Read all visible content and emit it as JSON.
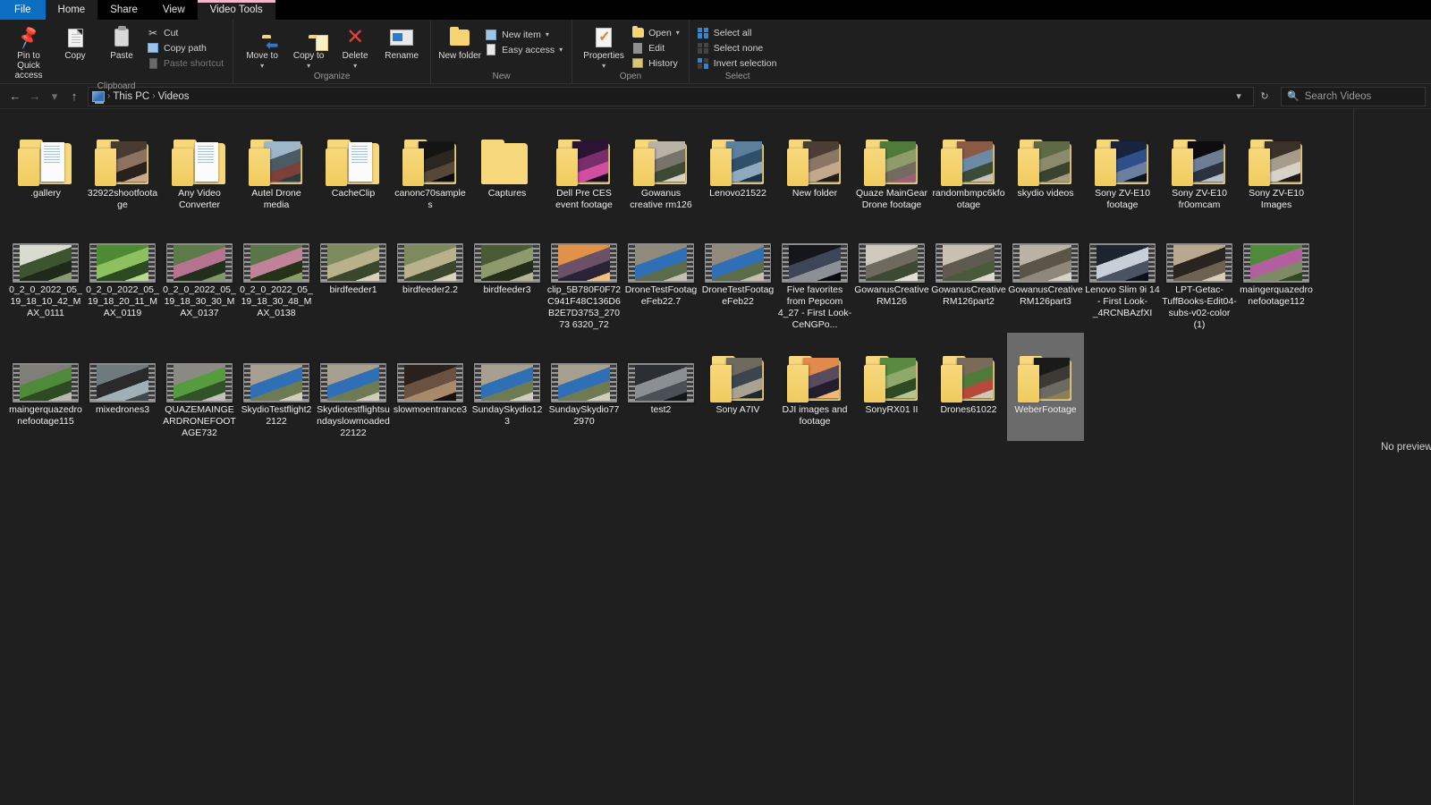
{
  "window": {
    "tabs": [
      {
        "id": "file",
        "label": "File",
        "kind": "file"
      },
      {
        "id": "home",
        "label": "Home",
        "kind": "active"
      },
      {
        "id": "share",
        "label": "Share",
        "kind": "normal"
      },
      {
        "id": "view",
        "label": "View",
        "kind": "normal"
      },
      {
        "id": "video-tools",
        "label": "Video Tools",
        "kind": "contextual"
      }
    ]
  },
  "ribbon": {
    "groups": [
      {
        "title": "Clipboard",
        "big": [
          {
            "name": "pin-to-quick-access",
            "label": "Pin to Quick access",
            "icon": "pin-icon"
          },
          {
            "name": "copy",
            "label": "Copy",
            "icon": "copy-icon"
          },
          {
            "name": "paste",
            "label": "Paste",
            "icon": "paste-icon"
          }
        ],
        "small": [
          {
            "name": "cut",
            "label": "Cut",
            "icon": "scissors-icon"
          },
          {
            "name": "copy-path",
            "label": "Copy path",
            "icon": "copy-path-icon"
          },
          {
            "name": "paste-shortcut",
            "label": "Paste shortcut",
            "icon": "paste-shortcut-icon",
            "disabled": true
          }
        ]
      },
      {
        "title": "Organize",
        "big": [
          {
            "name": "move-to",
            "label": "Move to",
            "icon": "move-to-icon",
            "caret": true
          },
          {
            "name": "copy-to",
            "label": "Copy to",
            "icon": "copy-to-icon",
            "caret": true
          },
          {
            "name": "delete",
            "label": "Delete",
            "icon": "delete-icon",
            "caret": true
          },
          {
            "name": "rename",
            "label": "Rename",
            "icon": "rename-icon"
          }
        ],
        "small": []
      },
      {
        "title": "New",
        "big": [
          {
            "name": "new-folder",
            "label": "New folder",
            "icon": "new-folder-icon"
          }
        ],
        "small": [
          {
            "name": "new-item",
            "label": "New item",
            "icon": "new-item-icon",
            "caret": true
          },
          {
            "name": "easy-access",
            "label": "Easy access",
            "icon": "easy-access-icon",
            "caret": true
          }
        ]
      },
      {
        "title": "Open",
        "big": [
          {
            "name": "properties",
            "label": "Properties",
            "icon": "properties-icon",
            "caret": true
          }
        ],
        "small": [
          {
            "name": "open",
            "label": "Open",
            "icon": "open-icon",
            "caret": true
          },
          {
            "name": "edit",
            "label": "Edit",
            "icon": "edit-icon"
          },
          {
            "name": "history",
            "label": "History",
            "icon": "history-icon"
          }
        ]
      },
      {
        "title": "Select",
        "big": [],
        "small": [
          {
            "name": "select-all",
            "label": "Select all",
            "icon": "select-all-icon"
          },
          {
            "name": "select-none",
            "label": "Select none",
            "icon": "select-none-icon"
          },
          {
            "name": "invert-selection",
            "label": "Invert selection",
            "icon": "invert-selection-icon"
          }
        ]
      }
    ]
  },
  "addressbar": {
    "back_icon": "back-arrow-icon",
    "forward_icon": "forward-arrow-icon",
    "recent_icon": "chevron-down-icon",
    "up_icon": "up-arrow-icon",
    "breadcrumb": [
      "This PC",
      "Videos"
    ],
    "separator": "›",
    "dropdown_icon": "chevron-down-icon",
    "refresh_icon": "refresh-icon",
    "search": {
      "placeholder": "Search Videos",
      "value": "",
      "icon": "search-icon"
    }
  },
  "preview": {
    "message": "No preview available."
  },
  "items": [
    {
      "name": ".gallery",
      "type": "folder",
      "thumb": "none"
    },
    {
      "name": "32922shootfootage",
      "type": "folder",
      "thumb": "indoor-person"
    },
    {
      "name": "Any Video Converter",
      "type": "folder",
      "thumb": "none"
    },
    {
      "name": "Autel Drone media",
      "type": "folder",
      "thumb": "aerial-city"
    },
    {
      "name": "CacheClip",
      "type": "folder",
      "thumb": "none"
    },
    {
      "name": "canonc70samples",
      "type": "folder",
      "thumb": "dark-interior"
    },
    {
      "name": "Captures",
      "type": "folder",
      "thumb": "empty"
    },
    {
      "name": "Dell Pre CES event footage",
      "type": "folder",
      "thumb": "stage-event"
    },
    {
      "name": "Gowanus creative rm126",
      "type": "folder",
      "thumb": "room-interior"
    },
    {
      "name": "Lenovo21522",
      "type": "folder",
      "thumb": "blue-seats"
    },
    {
      "name": "New folder",
      "type": "folder",
      "thumb": "hallway"
    },
    {
      "name": "Quaze MainGear Drone footage",
      "type": "folder",
      "thumb": "garden-path"
    },
    {
      "name": "randombmpc6kfootage",
      "type": "folder",
      "thumb": "house-exterior"
    },
    {
      "name": "skydio videos",
      "type": "folder",
      "thumb": "forest-trail"
    },
    {
      "name": "Sony ZV-E10 footage",
      "type": "folder",
      "thumb": "indoor-blue"
    },
    {
      "name": "Sony ZV-E10 fr0omcam",
      "type": "folder",
      "thumb": "winter-city"
    },
    {
      "name": "Sony ZV-E10 Images",
      "type": "folder",
      "thumb": "gear-table"
    },
    {
      "name": "0_2_0_2022_05_19_18_10_42_MAX_0111",
      "type": "video",
      "thumb": "hedge-house"
    },
    {
      "name": "0_2_0_2022_05_19_18_20_11_MAX_0119",
      "type": "video",
      "thumb": "green-foliage"
    },
    {
      "name": "0_2_0_2022_05_19_18_30_30_MAX_0137",
      "type": "video",
      "thumb": "pond-blossom"
    },
    {
      "name": "0_2_0_2022_05_19_18_30_48_MAX_0138",
      "type": "video",
      "thumb": "pond-blossom2"
    },
    {
      "name": "birdfeeder1",
      "type": "video",
      "thumb": "birdfeeder"
    },
    {
      "name": "birdfeeder2.2",
      "type": "video",
      "thumb": "birdfeeder"
    },
    {
      "name": "birdfeeder3",
      "type": "video",
      "thumb": "birdfeeder-dark"
    },
    {
      "name": "clip_5B780F0F72C941F48C136D6B2E7D3753_27073 6320_72",
      "type": "video",
      "thumb": "aerial-sunset"
    },
    {
      "name": "DroneTestFootageFeb22.7",
      "type": "video",
      "thumb": "drone-ground"
    },
    {
      "name": "DroneTestFootageFeb22",
      "type": "video",
      "thumb": "drone-ground"
    },
    {
      "name": "Five favorites from Pepcom 4_27 - First Look-CeNGPo...",
      "type": "video",
      "thumb": "expo-hall"
    },
    {
      "name": "GowanusCreative RM126",
      "type": "video",
      "thumb": "office-room"
    },
    {
      "name": "GowanusCreative RM126part2",
      "type": "video",
      "thumb": "office-room2"
    },
    {
      "name": "GowanusCreative RM126part3",
      "type": "video",
      "thumb": "corridor"
    },
    {
      "name": "Lenovo Slim 9i 14 - First Look-_4RCNBAzfXI",
      "type": "video",
      "thumb": "laptop-review"
    },
    {
      "name": "LPT-Getac-TuffBooks-Edit04-subs-v02-color (1)",
      "type": "video",
      "thumb": "man-interview"
    },
    {
      "name": "maingerquazedronefootage112",
      "type": "video",
      "thumb": "lawn-flowers"
    },
    {
      "name": "maingerquazedronefootage115",
      "type": "video",
      "thumb": "driveway-lawn"
    },
    {
      "name": "mixedrones3",
      "type": "video",
      "thumb": "wet-road"
    },
    {
      "name": "QUAZEMAINGEARDRONEFOOTAGE732",
      "type": "video",
      "thumb": "driveway-lawn2"
    },
    {
      "name": "SkydioTestflight22122",
      "type": "video",
      "thumb": "skydio-drone"
    },
    {
      "name": "Skydiotestflightsundayslowmoaded22122",
      "type": "video",
      "thumb": "skydio-drone"
    },
    {
      "name": "slowmoentrance3",
      "type": "video",
      "thumb": "person-doorway"
    },
    {
      "name": "SundaySkydio123",
      "type": "video",
      "thumb": "skydio-drone"
    },
    {
      "name": "SundaySkydio772970",
      "type": "video",
      "thumb": "skydio-drone"
    },
    {
      "name": "test2",
      "type": "video",
      "thumb": "studio-person"
    },
    {
      "name": "Sony A7IV",
      "type": "folder",
      "thumb": "street-building"
    },
    {
      "name": "DJI images and footage",
      "type": "folder",
      "thumb": "sunset-aerial"
    },
    {
      "name": "SonyRX01 II",
      "type": "folder",
      "thumb": "outdoor-green"
    },
    {
      "name": "Drones61022",
      "type": "folder",
      "thumb": "house-walk"
    },
    {
      "name": "WeberFootage",
      "type": "folder",
      "thumb": "grill-dark",
      "selected": true
    }
  ]
}
